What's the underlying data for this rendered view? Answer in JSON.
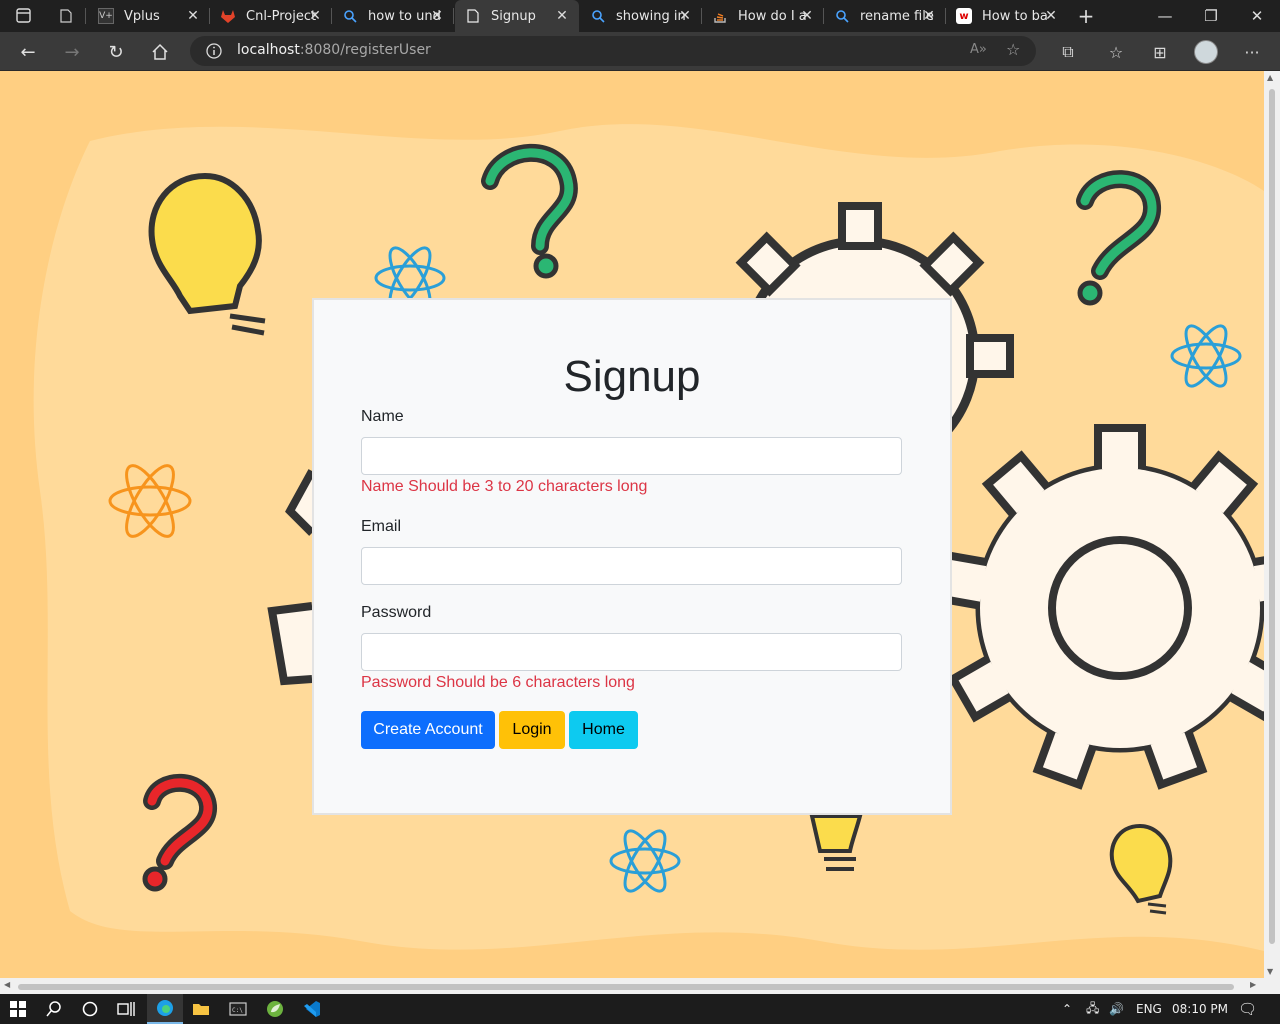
{
  "browser": {
    "tabs": [
      {
        "label": "Vplus",
        "icon": "vplus-favicon-icon",
        "active": false
      },
      {
        "label": "Cnl-Project",
        "icon": "gitlab-icon",
        "active": false
      },
      {
        "label": "how to und",
        "icon": "search-icon",
        "active": false
      },
      {
        "label": "Signup",
        "icon": "page-icon",
        "active": true
      },
      {
        "label": "showing in",
        "icon": "search-icon",
        "active": false
      },
      {
        "label": "How do I a",
        "icon": "stackoverflow-icon",
        "active": false
      },
      {
        "label": "rename file",
        "icon": "search-icon",
        "active": false
      },
      {
        "label": "How to ba",
        "icon": "w-favicon-icon",
        "active": false
      }
    ],
    "url_host": "localhost",
    "url_rest": ":8080/registerUser"
  },
  "form": {
    "title": "Signup",
    "name_label": "Name",
    "name_value": "",
    "name_error": "Name Should be 3 to 20 characters long",
    "email_label": "Email",
    "email_value": "",
    "password_label": "Password",
    "password_value": "",
    "password_error": "Password Should be 6 characters long",
    "create_label": "Create Account",
    "login_label": "Login",
    "home_label": "Home"
  },
  "taskbar": {
    "language": "ENG",
    "time": "08:10 PM"
  },
  "colors": {
    "background": "#ffcf82",
    "primary": "#0d6efd",
    "warning": "#ffc107",
    "info": "#0dcaf0",
    "error": "#dc3545"
  }
}
